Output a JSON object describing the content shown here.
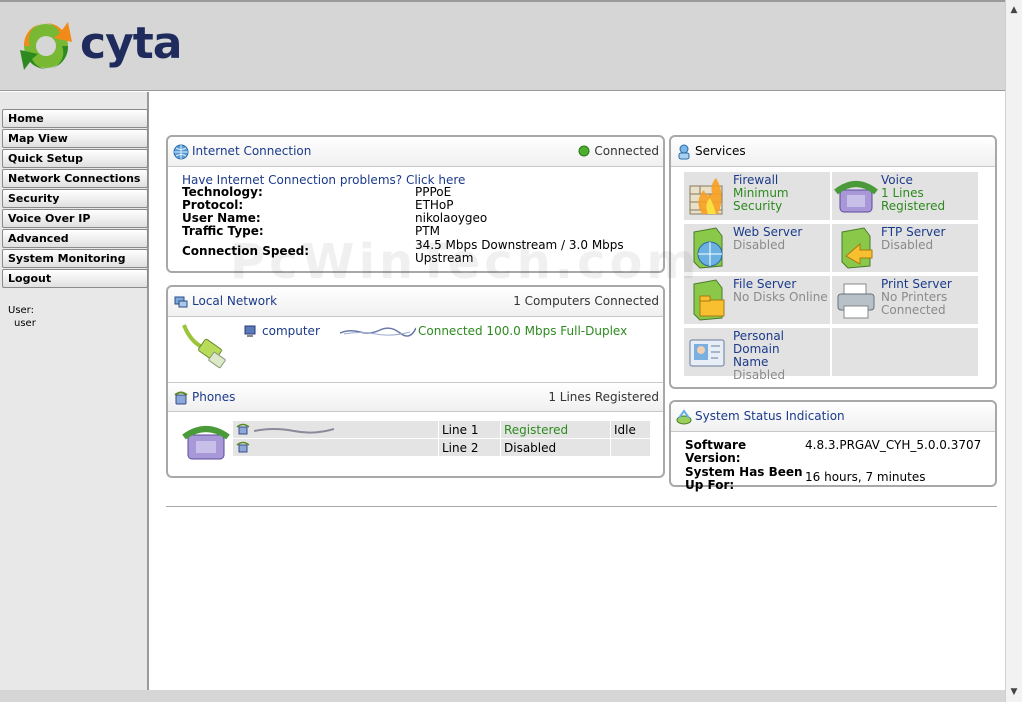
{
  "header": {
    "brand": "cyta"
  },
  "nav": [
    {
      "label": "Home",
      "id": "home"
    },
    {
      "label": "Map View",
      "id": "map-view"
    },
    {
      "label": "Quick Setup",
      "id": "quick-setup"
    },
    {
      "label": "Network Connections",
      "id": "network-connections"
    },
    {
      "label": "Security",
      "id": "security"
    },
    {
      "label": "Voice Over IP",
      "id": "voice-over-ip"
    },
    {
      "label": "Advanced",
      "id": "advanced"
    },
    {
      "label": "System Monitoring",
      "id": "system-monitoring"
    },
    {
      "label": "Logout",
      "id": "logout"
    }
  ],
  "user": {
    "label": "User:",
    "value": "user"
  },
  "internet": {
    "title": "Internet Connection",
    "status": "Connected",
    "problem_link": "Have Internet Connection problems? Click here",
    "rows": [
      {
        "k": "Technology:",
        "v": "PPPoE"
      },
      {
        "k": "Protocol:",
        "v": "ETHoP"
      },
      {
        "k": "User Name:",
        "v": "nikolaoygeo"
      },
      {
        "k": "Traffic Type:",
        "v": "PTM"
      },
      {
        "k": "Connection Speed:",
        "v": "34.5 Mbps Downstream / 3.0 Mbps Upstream"
      }
    ]
  },
  "local_network": {
    "title": "Local Network",
    "summary": "1 Computers Connected",
    "device": {
      "name": "computer",
      "status": "Connected 100.0 Mbps Full-Duplex"
    }
  },
  "phones": {
    "title": "Phones",
    "summary": "1 Lines Registered",
    "lines": [
      {
        "line": "Line 1",
        "status": "Registered",
        "state": "Idle"
      },
      {
        "line": "Line 2",
        "status": "Disabled",
        "state": ""
      }
    ]
  },
  "services": {
    "title": "Services",
    "items": [
      {
        "name": "Firewall",
        "l2": "Minimum",
        "l3": "Security",
        "color": "green"
      },
      {
        "name": "Voice",
        "l2": "1 Lines",
        "l3": "Registered",
        "color": "green"
      },
      {
        "name": "Web Server",
        "l2": "Disabled",
        "l3": "",
        "color": "gray"
      },
      {
        "name": "FTP Server",
        "l2": "Disabled",
        "l3": "",
        "color": "gray"
      },
      {
        "name": "File Server",
        "l2": "No Disks Online",
        "l3": "",
        "color": "gray"
      },
      {
        "name": "Print Server",
        "l2": "No Printers",
        "l3": "Connected",
        "color": "gray"
      },
      {
        "name": "Personal Domain",
        "l2": "Name",
        "l3": "Disabled",
        "color": "gray"
      }
    ]
  },
  "system_status": {
    "title": "System Status Indication",
    "software_label": "Software Version:",
    "software_value": "4.8.3.PRGAV_CYH_5.0.0.3707",
    "uptime_label": "System Has Been Up For:",
    "uptime_value": "16 hours, 7 minutes"
  },
  "watermark": "PcWinTech.com",
  "colors": {
    "link": "#1b3a8a",
    "ok": "#2d8a1e",
    "muted": "#8a8a8a"
  }
}
